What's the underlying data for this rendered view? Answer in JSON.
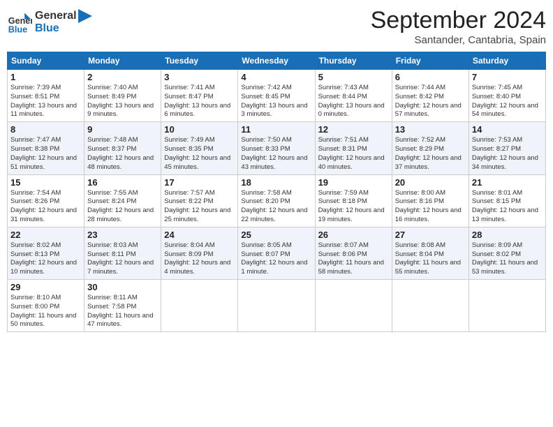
{
  "header": {
    "logo_line1": "General",
    "logo_line2": "Blue",
    "month": "September 2024",
    "location": "Santander, Cantabria, Spain"
  },
  "days_of_week": [
    "Sunday",
    "Monday",
    "Tuesday",
    "Wednesday",
    "Thursday",
    "Friday",
    "Saturday"
  ],
  "weeks": [
    [
      {
        "day": "1",
        "info": "Sunrise: 7:39 AM\nSunset: 8:51 PM\nDaylight: 13 hours and 11 minutes."
      },
      {
        "day": "2",
        "info": "Sunrise: 7:40 AM\nSunset: 8:49 PM\nDaylight: 13 hours and 9 minutes."
      },
      {
        "day": "3",
        "info": "Sunrise: 7:41 AM\nSunset: 8:47 PM\nDaylight: 13 hours and 6 minutes."
      },
      {
        "day": "4",
        "info": "Sunrise: 7:42 AM\nSunset: 8:45 PM\nDaylight: 13 hours and 3 minutes."
      },
      {
        "day": "5",
        "info": "Sunrise: 7:43 AM\nSunset: 8:44 PM\nDaylight: 13 hours and 0 minutes."
      },
      {
        "day": "6",
        "info": "Sunrise: 7:44 AM\nSunset: 8:42 PM\nDaylight: 12 hours and 57 minutes."
      },
      {
        "day": "7",
        "info": "Sunrise: 7:45 AM\nSunset: 8:40 PM\nDaylight: 12 hours and 54 minutes."
      }
    ],
    [
      {
        "day": "8",
        "info": "Sunrise: 7:47 AM\nSunset: 8:38 PM\nDaylight: 12 hours and 51 minutes."
      },
      {
        "day": "9",
        "info": "Sunrise: 7:48 AM\nSunset: 8:37 PM\nDaylight: 12 hours and 48 minutes."
      },
      {
        "day": "10",
        "info": "Sunrise: 7:49 AM\nSunset: 8:35 PM\nDaylight: 12 hours and 45 minutes."
      },
      {
        "day": "11",
        "info": "Sunrise: 7:50 AM\nSunset: 8:33 PM\nDaylight: 12 hours and 43 minutes."
      },
      {
        "day": "12",
        "info": "Sunrise: 7:51 AM\nSunset: 8:31 PM\nDaylight: 12 hours and 40 minutes."
      },
      {
        "day": "13",
        "info": "Sunrise: 7:52 AM\nSunset: 8:29 PM\nDaylight: 12 hours and 37 minutes."
      },
      {
        "day": "14",
        "info": "Sunrise: 7:53 AM\nSunset: 8:27 PM\nDaylight: 12 hours and 34 minutes."
      }
    ],
    [
      {
        "day": "15",
        "info": "Sunrise: 7:54 AM\nSunset: 8:26 PM\nDaylight: 12 hours and 31 minutes."
      },
      {
        "day": "16",
        "info": "Sunrise: 7:55 AM\nSunset: 8:24 PM\nDaylight: 12 hours and 28 minutes."
      },
      {
        "day": "17",
        "info": "Sunrise: 7:57 AM\nSunset: 8:22 PM\nDaylight: 12 hours and 25 minutes."
      },
      {
        "day": "18",
        "info": "Sunrise: 7:58 AM\nSunset: 8:20 PM\nDaylight: 12 hours and 22 minutes."
      },
      {
        "day": "19",
        "info": "Sunrise: 7:59 AM\nSunset: 8:18 PM\nDaylight: 12 hours and 19 minutes."
      },
      {
        "day": "20",
        "info": "Sunrise: 8:00 AM\nSunset: 8:16 PM\nDaylight: 12 hours and 16 minutes."
      },
      {
        "day": "21",
        "info": "Sunrise: 8:01 AM\nSunset: 8:15 PM\nDaylight: 12 hours and 13 minutes."
      }
    ],
    [
      {
        "day": "22",
        "info": "Sunrise: 8:02 AM\nSunset: 8:13 PM\nDaylight: 12 hours and 10 minutes."
      },
      {
        "day": "23",
        "info": "Sunrise: 8:03 AM\nSunset: 8:11 PM\nDaylight: 12 hours and 7 minutes."
      },
      {
        "day": "24",
        "info": "Sunrise: 8:04 AM\nSunset: 8:09 PM\nDaylight: 12 hours and 4 minutes."
      },
      {
        "day": "25",
        "info": "Sunrise: 8:05 AM\nSunset: 8:07 PM\nDaylight: 12 hours and 1 minute."
      },
      {
        "day": "26",
        "info": "Sunrise: 8:07 AM\nSunset: 8:06 PM\nDaylight: 11 hours and 58 minutes."
      },
      {
        "day": "27",
        "info": "Sunrise: 8:08 AM\nSunset: 8:04 PM\nDaylight: 11 hours and 55 minutes."
      },
      {
        "day": "28",
        "info": "Sunrise: 8:09 AM\nSunset: 8:02 PM\nDaylight: 11 hours and 53 minutes."
      }
    ],
    [
      {
        "day": "29",
        "info": "Sunrise: 8:10 AM\nSunset: 8:00 PM\nDaylight: 11 hours and 50 minutes."
      },
      {
        "day": "30",
        "info": "Sunrise: 8:11 AM\nSunset: 7:58 PM\nDaylight: 11 hours and 47 minutes."
      },
      null,
      null,
      null,
      null,
      null
    ]
  ]
}
